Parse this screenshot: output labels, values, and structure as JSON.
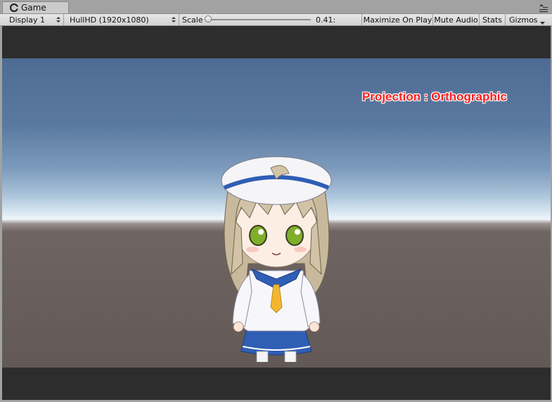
{
  "window": {
    "tab_label": "Game",
    "tab_icon": "unity-logo-icon",
    "menu_icon": "panel-menu-icon"
  },
  "toolbar": {
    "display": "Display 1",
    "resolution": "HullHD (1920x1080)",
    "scale_label": "Scale",
    "scale_value": "0.41:",
    "scale_fraction": 0.0,
    "maximize_on_play": "Maximize On Play",
    "mute_audio": "Mute Audio",
    "stats": "Stats",
    "gizmos": "Gizmos"
  },
  "game_view": {
    "projection_label": "Projection : Orthographic",
    "projection_color": "#ff1c1c",
    "letterbox_color": "#2d2d2d",
    "sky_color": "#5b7aa0",
    "horizon_color": "#eef5fa",
    "ground_color": "#625956"
  }
}
